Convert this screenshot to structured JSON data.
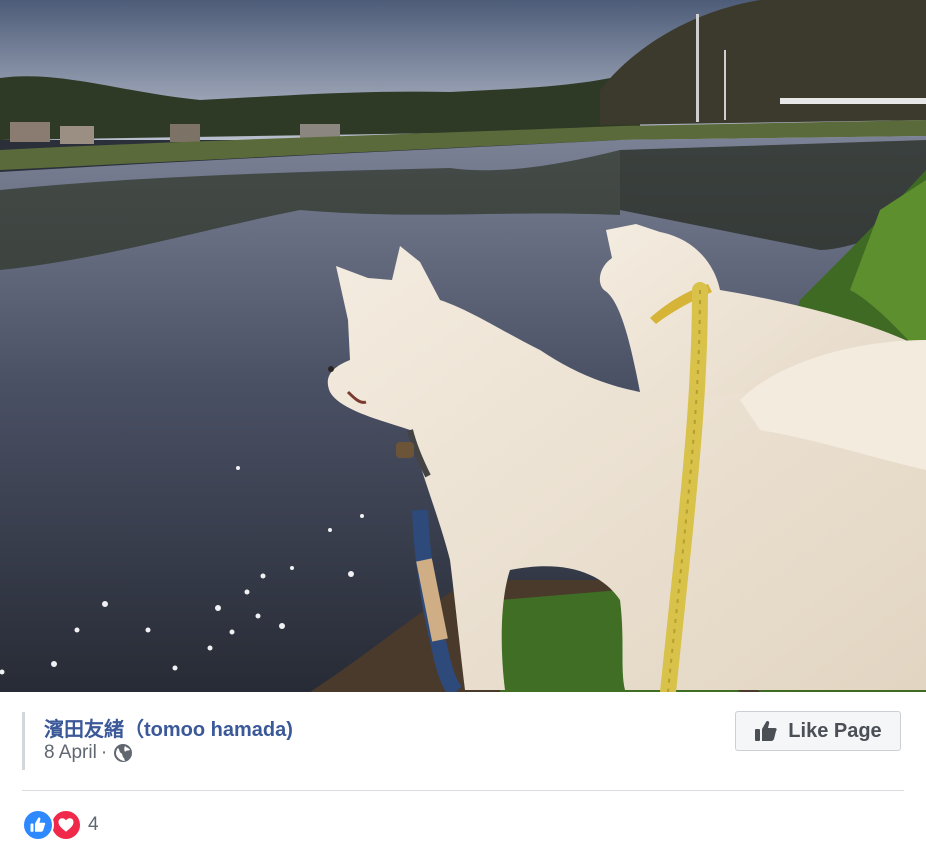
{
  "photo": {
    "alt": "Two white dogs on leashes looking at a flooded rice field at dusk",
    "colors": {
      "sky_top": "#5b6a85",
      "sky_bottom": "#c3c7d1",
      "water": "#3a4050",
      "dog": "#efe6d8",
      "leash_yellow": "#d8c24a",
      "grass": "#4b7a2c"
    }
  },
  "post": {
    "author": "濱田友緒（tomoo hamada)",
    "date": "8 April",
    "separator": "·",
    "privacy_icon": "globe-icon",
    "like_page_label": "Like Page",
    "like_page_icon": "thumbs-up-icon"
  },
  "reactions": {
    "types": [
      "like",
      "love"
    ],
    "count": "4",
    "colors": {
      "like": "#2e89ff",
      "love": "#f0284a"
    }
  }
}
